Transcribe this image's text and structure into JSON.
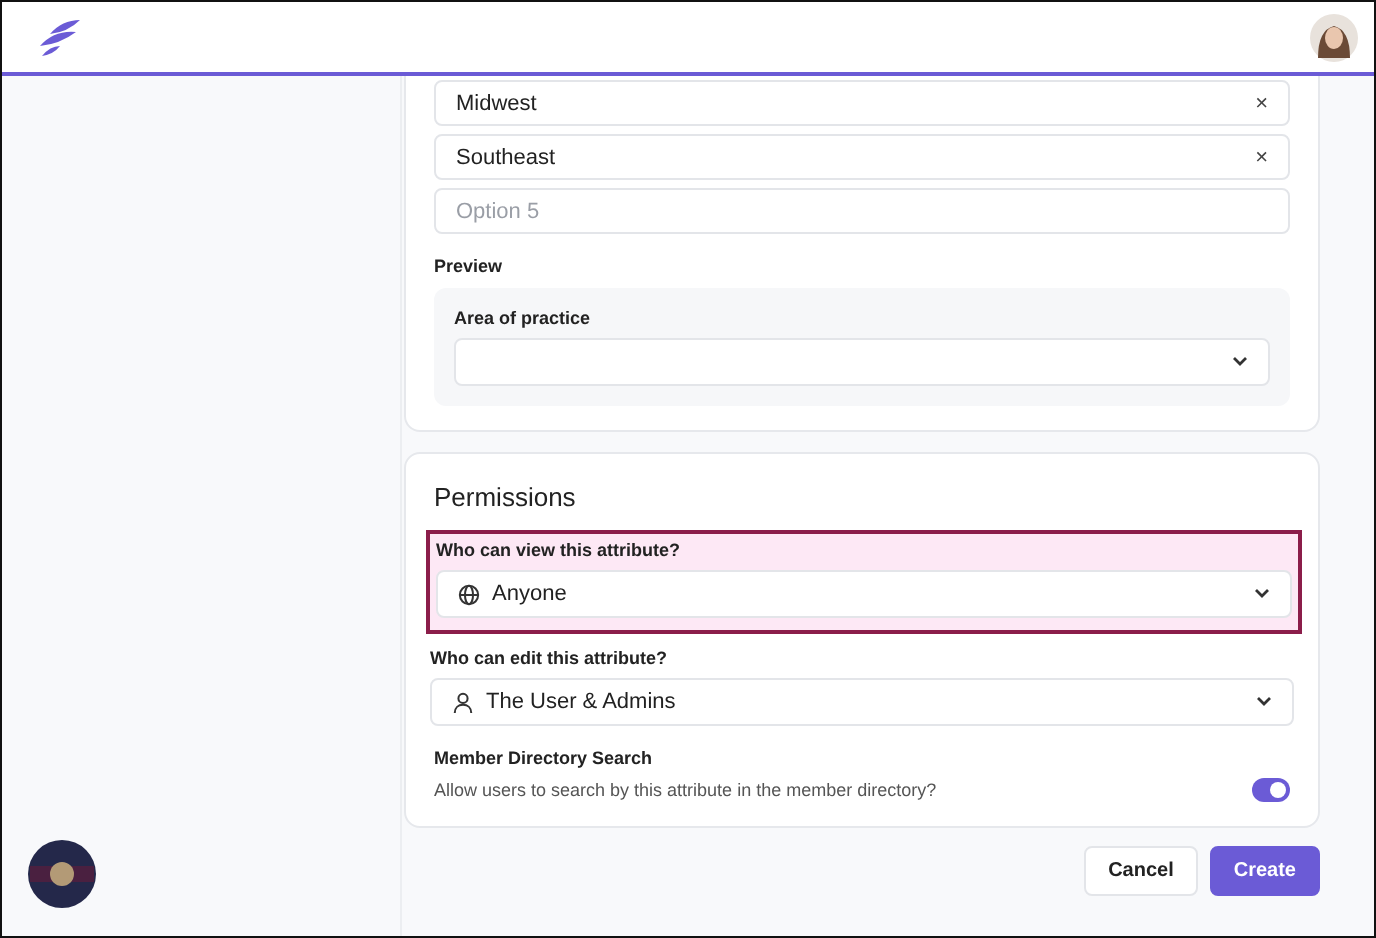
{
  "options": [
    {
      "value": "Midwest",
      "remove": "×"
    },
    {
      "value": "Southeast",
      "remove": "×"
    },
    {
      "placeholder": "Option 5"
    }
  ],
  "preview": {
    "title": "Preview",
    "field_label": "Area of practice"
  },
  "permissions": {
    "title": "Permissions",
    "fields": [
      {
        "label": "Who can view this attribute?",
        "value": "Anyone",
        "highlighted": true
      },
      {
        "label": "Who can edit this attribute?",
        "value": "The User & Admins",
        "highlighted": false
      }
    ],
    "search": {
      "title": "Member Directory Search",
      "description": "Allow users to search by this attribute in the member directory?",
      "on": true
    }
  },
  "buttons": [
    {
      "label": "Cancel",
      "kind": "secondary"
    },
    {
      "label": "Create",
      "kind": "primary"
    }
  ]
}
